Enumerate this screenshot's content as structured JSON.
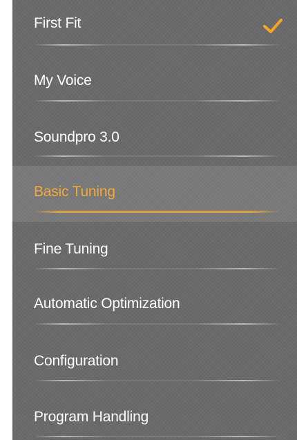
{
  "menu": {
    "items": [
      {
        "label": "First Fit",
        "checked": true,
        "active": false
      },
      {
        "label": "My Voice",
        "checked": false,
        "active": false
      },
      {
        "label": "Soundpro 3.0",
        "checked": false,
        "active": false
      },
      {
        "label": "Basic Tuning",
        "checked": false,
        "active": true
      },
      {
        "label": "Fine Tuning",
        "checked": false,
        "active": false
      },
      {
        "label": "Automatic Optimization",
        "checked": false,
        "active": false
      },
      {
        "label": "Configuration",
        "checked": false,
        "active": false
      },
      {
        "label": "Program Handling",
        "checked": false,
        "active": false
      }
    ]
  },
  "colors": {
    "panel_background": "#6a6a6a",
    "text": "#ffffff",
    "accent": "#f2a93b",
    "checkmark": "#f5a623"
  },
  "icons": {
    "check": "check-icon"
  }
}
